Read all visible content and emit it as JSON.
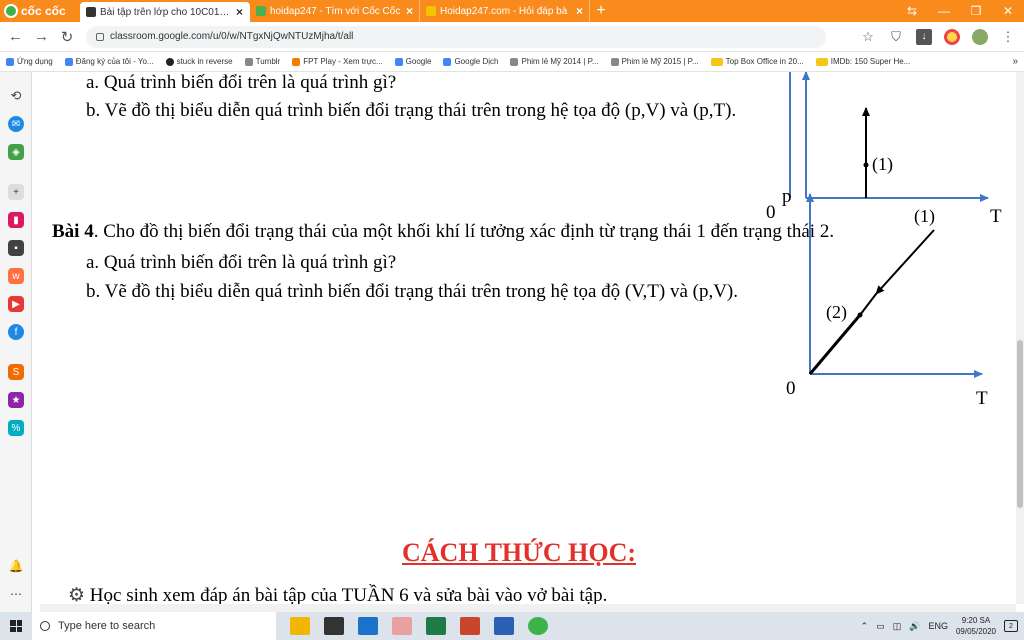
{
  "browser": {
    "brand": "cốc cốc",
    "tabs": [
      {
        "title": "Bài tập trên lớp cho 10C01 - T",
        "active": true
      },
      {
        "title": "hoidap247 - Tìm với Cốc Cốc",
        "active": false
      },
      {
        "title": "Hoidap247.com - Hỏi đáp bà",
        "active": false
      }
    ],
    "url": "classroom.google.com/u/0/w/NTgxNjQwNTUzMjha/t/all",
    "bookmarks": [
      "Ứng dụng",
      "Đăng ký của tôi - Yo...",
      "stuck in reverse",
      "Tumblr",
      "FPT Play - Xem trực...",
      "Google",
      "Google Dịch",
      "Phim lẻ Mỹ 2014 | P...",
      "Phim lẻ Mỹ 2015 | P...",
      "Top Box Office in 20...",
      "IMDb: 150 Super He..."
    ],
    "bookmarks_more": "»"
  },
  "document": {
    "lines_top": [
      "a. Quá trình biến đổi trên là quá trình gì?",
      "b. Vẽ đồ thị biểu diễn quá trình biến đổi trạng thái trên trong hệ tọa độ (p,V) và (p,T)."
    ],
    "bai4_label": "Bài 4",
    "bai4_text": ". Cho đồ thị biến đổi trạng thái của một khối khí lí tưởng xác định từ trạng thái 1 đến trạng thái 2.",
    "lines_bai4": [
      "a. Quá trình biến đổi trên là quá trình gì?",
      "b. Vẽ đồ thị biểu diễn quá trình biến đổi trạng thái trên trong hệ tọa độ (V,T) và (p,V)."
    ],
    "heading": "CÁCH THỨC HỌC:",
    "bottom_line": "Học sinh xem đáp án bài tập của TUẦN 6 và sửa bài vào vở bài tập."
  },
  "graph_top": {
    "origin": "0",
    "y_axis": "p",
    "x_axis": "T",
    "point_label": "(1)"
  },
  "graph_bottom": {
    "origin": "0",
    "x_axis": "T",
    "point1": "(1)",
    "point2": "(2)"
  },
  "taskbar": {
    "search_placeholder": "Type here to search",
    "lang": "ENG",
    "time": "9:20 SA",
    "date": "09/05/2020",
    "notifications": "2"
  },
  "colors": {
    "tabbar": "#f98a1c",
    "axis": "#3f77c6",
    "heading": "#e0312c"
  }
}
